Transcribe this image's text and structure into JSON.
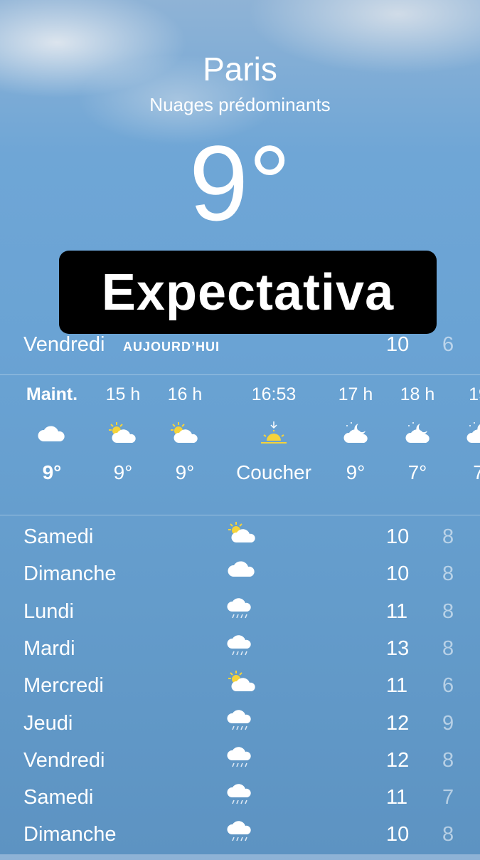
{
  "header": {
    "city": "Paris",
    "condition": "Nuages prédominants",
    "temperature": "9°"
  },
  "banner": {
    "text": "Expectativa"
  },
  "today": {
    "day": "Vendredi",
    "tag": "AUJOURD’HUI",
    "high": "10",
    "low": "6"
  },
  "hourly": [
    {
      "time": "Maint.",
      "icon": "cloud-icon",
      "temp": "9°"
    },
    {
      "time": "15 h",
      "icon": "partly-sunny-icon",
      "temp": "9°"
    },
    {
      "time": "16 h",
      "icon": "partly-sunny-icon",
      "temp": "9°"
    },
    {
      "time": "16:53",
      "icon": "sunset-icon",
      "temp": "Coucher"
    },
    {
      "time": "17 h",
      "icon": "partly-cloudy-night-icon",
      "temp": "9°"
    },
    {
      "time": "18 h",
      "icon": "partly-cloudy-night-icon",
      "temp": "7°"
    },
    {
      "time": "19",
      "icon": "partly-cloudy-night-icon",
      "temp": "7"
    }
  ],
  "daily": [
    {
      "day": "Samedi",
      "icon": "partly-sunny-icon",
      "high": "10",
      "low": "8"
    },
    {
      "day": "Dimanche",
      "icon": "cloud-icon",
      "high": "10",
      "low": "8"
    },
    {
      "day": "Lundi",
      "icon": "rain-icon",
      "high": "11",
      "low": "8"
    },
    {
      "day": "Mardi",
      "icon": "rain-icon",
      "high": "13",
      "low": "8"
    },
    {
      "day": "Mercredi",
      "icon": "partly-sunny-icon",
      "high": "11",
      "low": "6"
    },
    {
      "day": "Jeudi",
      "icon": "rain-icon",
      "high": "12",
      "low": "9"
    },
    {
      "day": "Vendredi",
      "icon": "rain-icon",
      "high": "12",
      "low": "8"
    },
    {
      "day": "Samedi",
      "icon": "rain-icon",
      "high": "11",
      "low": "7"
    },
    {
      "day": "Dimanche",
      "icon": "rain-icon",
      "high": "10",
      "low": "8"
    }
  ]
}
